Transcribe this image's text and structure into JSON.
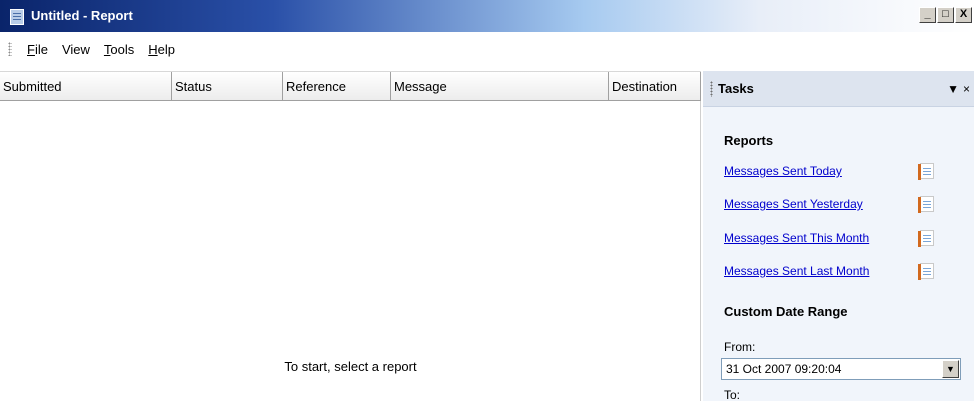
{
  "window": {
    "title": "Untitled - Report",
    "buttons": {
      "minimize": "_",
      "maximize": "□",
      "close": "X"
    }
  },
  "menu": {
    "items": [
      {
        "label_pre": "",
        "accel": "F",
        "label_post": "ile"
      },
      {
        "label_pre": "View",
        "accel": "",
        "label_post": ""
      },
      {
        "label_pre": "",
        "accel": "T",
        "label_post": "ools"
      },
      {
        "label_pre": "",
        "accel": "H",
        "label_post": "elp"
      }
    ]
  },
  "list": {
    "columns": [
      "Submitted",
      "Status",
      "Reference",
      "Message",
      "Destination"
    ],
    "empty_message": "To start, select a report"
  },
  "tasks": {
    "title": "Tasks",
    "controls": {
      "dropdown": "▼",
      "close": "×"
    },
    "reports_heading": "Reports",
    "reports": [
      "Messages Sent Today",
      "Messages Sent Yesterday",
      "Messages Sent This Month",
      "Messages Sent Last Month"
    ],
    "custom_heading": "Custom Date Range",
    "from_label": "From:",
    "from_value": "31 Oct  2007 09:20:04",
    "to_label": "To:"
  },
  "icons": {
    "app": "report-app-icon",
    "report": "report-document-icon",
    "dropdown": "chevron-down-icon"
  }
}
